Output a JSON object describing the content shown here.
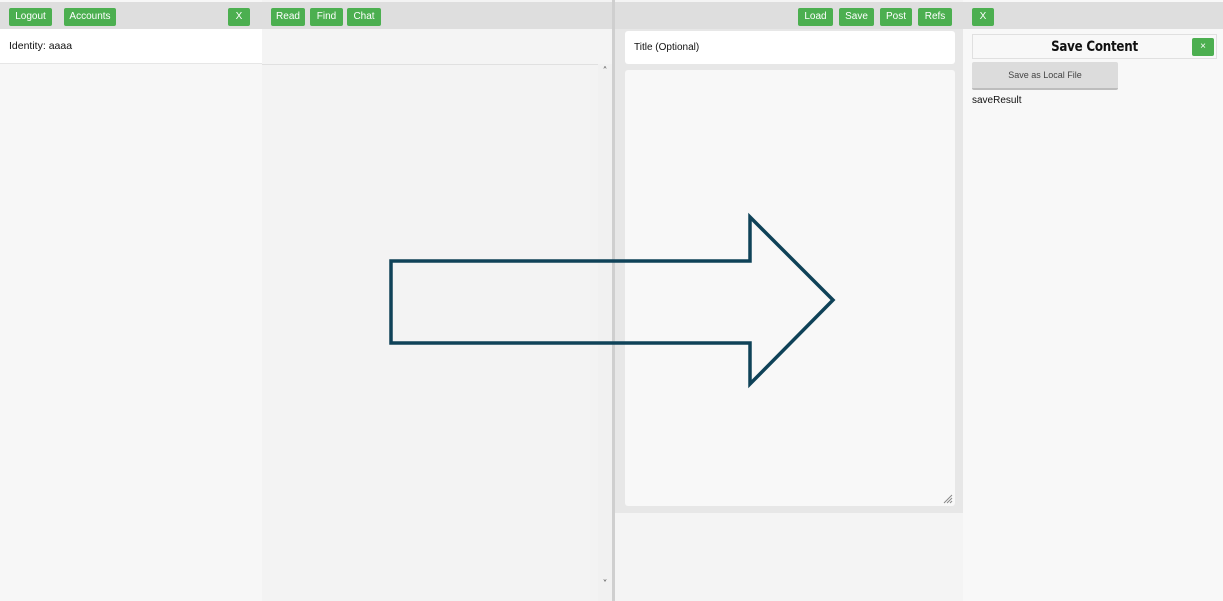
{
  "panel_accounts": {
    "buttons": {
      "logout": "Logout",
      "accounts": "Accounts",
      "close": "X"
    },
    "identity": "Identity: aaaa"
  },
  "panel_browse": {
    "buttons": {
      "read": "Read",
      "find": "Find",
      "chat": "Chat"
    },
    "scroll_up_icon": "˄",
    "scroll_down_icon": "˅"
  },
  "panel_editor": {
    "buttons": {
      "load": "Load",
      "save": "Save",
      "post": "Post",
      "refs": "Refs",
      "close": "X"
    },
    "title_placeholder": "Title (Optional)",
    "content_value": ""
  },
  "panel_save": {
    "title": "Save Content",
    "close": "×",
    "save_local": "Save as Local File",
    "result": "saveResult"
  },
  "overlay": {
    "icon": "right-arrow-icon",
    "stroke_color": "#0f4258"
  },
  "colors": {
    "accent": "#4caf50",
    "toolbar": "#dedede"
  }
}
